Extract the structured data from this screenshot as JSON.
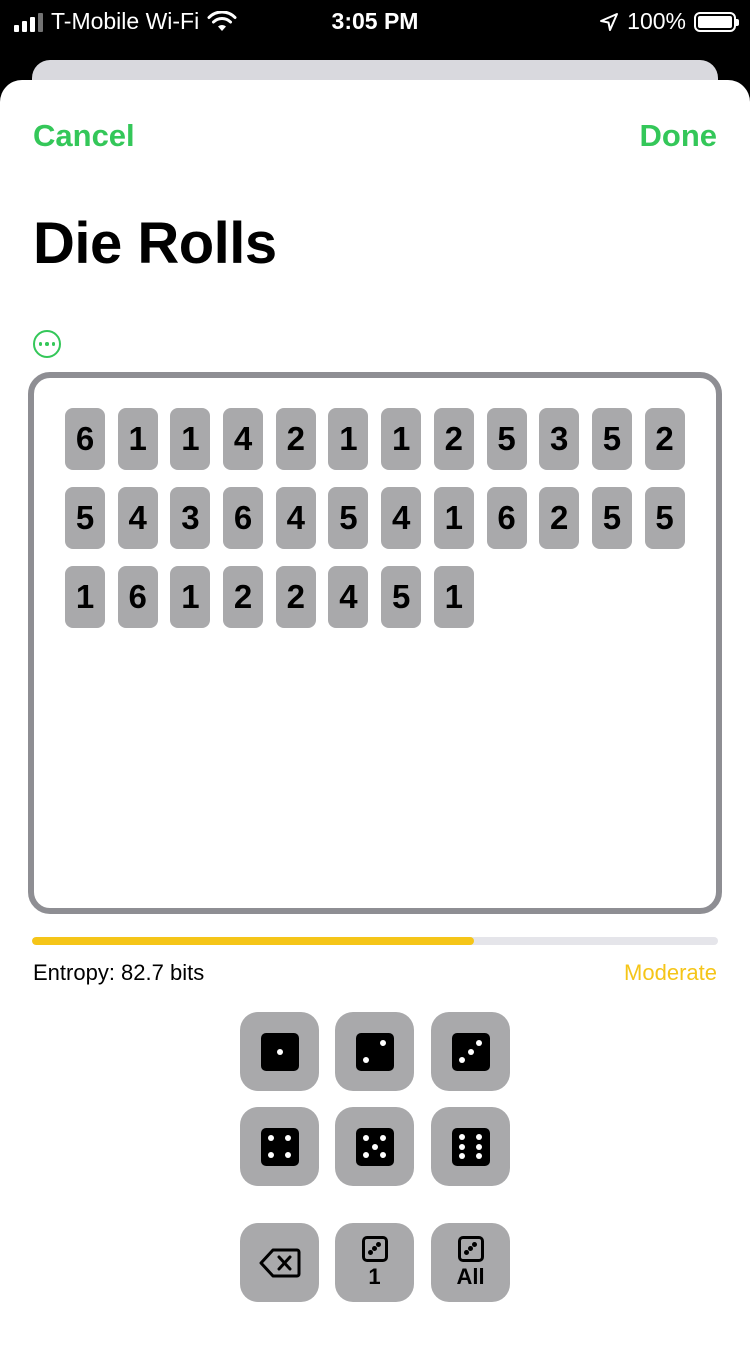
{
  "status_bar": {
    "carrier": "T-Mobile Wi-Fi",
    "time": "3:05 PM",
    "battery": "100%",
    "icons": [
      "signal-icon",
      "wifi-icon",
      "location-arrow-icon",
      "battery-icon"
    ]
  },
  "nav": {
    "cancel_label": "Cancel",
    "done_label": "Done"
  },
  "title": "Die Rolls",
  "more_icon": "ellipsis-circle-icon",
  "rolls": [
    "6",
    "1",
    "1",
    "4",
    "2",
    "1",
    "1",
    "2",
    "5",
    "3",
    "5",
    "2",
    "5",
    "4",
    "3",
    "6",
    "4",
    "5",
    "4",
    "1",
    "6",
    "2",
    "5",
    "5",
    "1",
    "6",
    "1",
    "2",
    "2",
    "4",
    "5",
    "1"
  ],
  "entropy": {
    "label": "Entropy: 82.7 bits",
    "strength": "Moderate",
    "progress_fraction": 0.645
  },
  "keypad": {
    "faces": [
      1,
      2,
      3,
      4,
      5,
      6
    ],
    "backspace_icon": "backspace-icon",
    "one_label": "1",
    "all_label": "All"
  },
  "colors": {
    "accent": "#34c759",
    "moderate": "#f5c518",
    "key_bg": "#a9a9ab",
    "border": "#8e8e93"
  }
}
